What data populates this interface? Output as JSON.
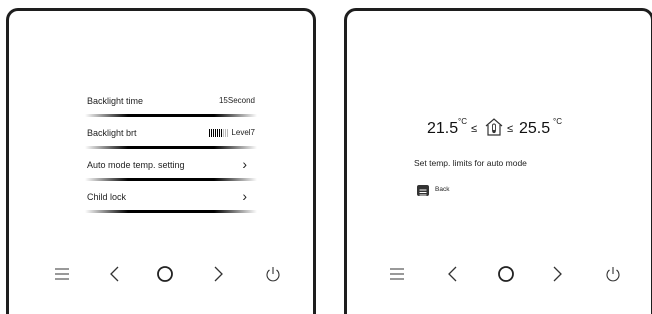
{
  "left_screen": {
    "menu": [
      {
        "label": "Backlight time",
        "value": "15Second"
      },
      {
        "label": "Backlight brt",
        "value": "Level7",
        "level": 7,
        "level_max": 10
      },
      {
        "label": "Auto mode temp. setting",
        "arrow": "chevron-right-icon"
      },
      {
        "label": "Child lock",
        "arrow": "chevron-right-icon"
      }
    ]
  },
  "right_screen": {
    "low_temp": "21.5",
    "high_temp": "25.5",
    "unit": "°C",
    "leq": "≤",
    "hint": "Set temp. limits for auto mode",
    "back_label": "Back"
  },
  "buttons": [
    "menu-icon",
    "chevron-left-icon",
    "ok-circle-icon",
    "chevron-right-icon",
    "power-icon"
  ]
}
